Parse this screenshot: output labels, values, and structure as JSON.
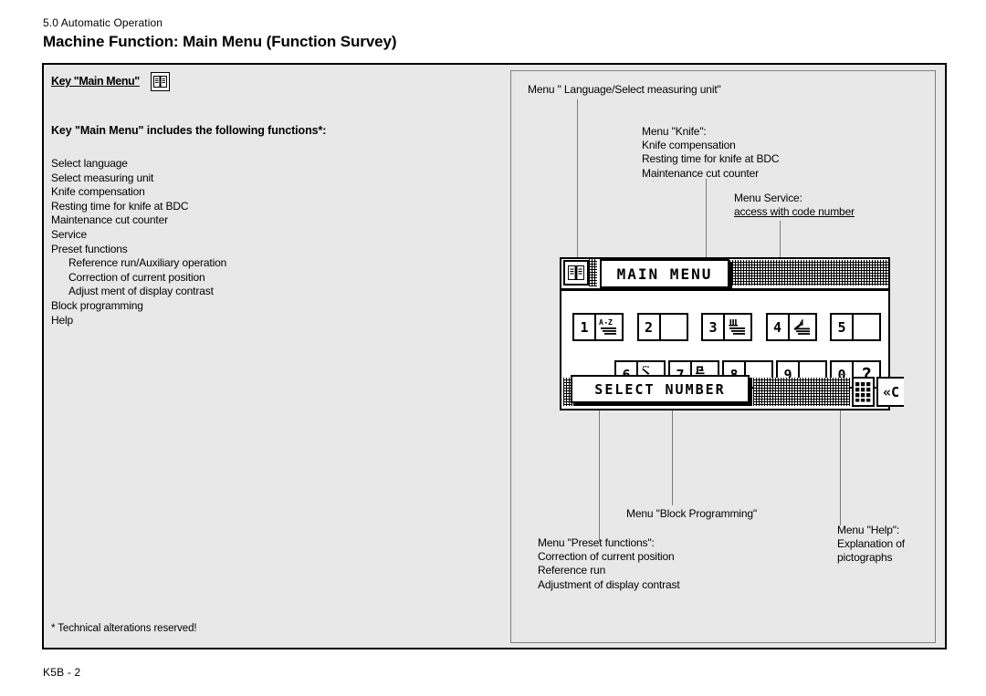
{
  "header": {
    "section_number": "5.0 Automatic Operation",
    "title": "Machine Function: Main Menu (Function Survey)"
  },
  "left_column": {
    "key_label": "Key \"Main Menu\"",
    "key_icon": "open-book-icon",
    "functions_heading": "Key \"Main Menu\" includes the following functions*:",
    "functions": [
      {
        "label": "Select language",
        "indent": 0
      },
      {
        "label": "Select measuring unit",
        "indent": 0
      },
      {
        "label": "Knife compensation",
        "indent": 0
      },
      {
        "label": "Resting time for knife at BDC",
        "indent": 0
      },
      {
        "label": "Maintenance cut counter",
        "indent": 0
      },
      {
        "label": "Service",
        "indent": 0
      },
      {
        "label": "Preset functions",
        "indent": 0
      },
      {
        "label": "Reference run/Auxiliary operation",
        "indent": 1
      },
      {
        "label": "Correction of current position",
        "indent": 1
      },
      {
        "label": "Adjust ment of display contrast",
        "indent": 1
      },
      {
        "label": "Block programming",
        "indent": 0
      },
      {
        "label": "Help",
        "indent": 0
      }
    ],
    "footnote": "* Technical alterations reserved!"
  },
  "right_panel": {
    "annotations": [
      {
        "name": "annotation-language",
        "lines": [
          {
            "text": "Menu \" Language/Select measuring unit\"",
            "underlined": false
          }
        ]
      },
      {
        "name": "annotation-knife",
        "lines": [
          {
            "text": "Menu \"Knife\":",
            "underlined": false
          },
          {
            "text": "Knife compensation",
            "underlined": false
          },
          {
            "text": "Resting time for knife at BDC",
            "underlined": false
          },
          {
            "text": "Maintenance cut counter",
            "underlined": false
          }
        ]
      },
      {
        "name": "annotation-service",
        "lines": [
          {
            "text": "Menu Service:",
            "underlined": false
          },
          {
            "text": "access with code number",
            "underlined": true
          }
        ]
      },
      {
        "name": "annotation-block-programming",
        "lines": [
          {
            "text": "Menu \"Block Programming\"",
            "underlined": false
          }
        ]
      },
      {
        "name": "annotation-preset-functions",
        "lines": [
          {
            "text": "Menu \"Preset functions\":",
            "underlined": false
          },
          {
            "text": "Correction of current position",
            "underlined": false
          },
          {
            "text": "Reference run",
            "underlined": false
          },
          {
            "text": "Adjustment of display contrast",
            "underlined": false
          }
        ]
      },
      {
        "name": "annotation-help",
        "lines": [
          {
            "text": "Menu \"Help\":",
            "underlined": false
          },
          {
            "text": "Explanation of",
            "underlined": false
          },
          {
            "text": "pictographs",
            "underlined": false
          }
        ]
      }
    ]
  },
  "lcd": {
    "title": "MAIN MENU",
    "status": "SELECT NUMBER",
    "book_icon": "open-book-icon",
    "keypad_icon": "keypad-icon",
    "clear_label": "«C",
    "row1": [
      {
        "number": "1",
        "icon": "language-az-icon"
      },
      {
        "number": "2",
        "icon": ""
      },
      {
        "number": "3",
        "icon": "knife-icon"
      },
      {
        "number": "4",
        "icon": "wrench-service-icon"
      },
      {
        "number": "5",
        "icon": ""
      }
    ],
    "row2": [
      {
        "number": "6",
        "icon": "preset-functions-icon"
      },
      {
        "number": "7",
        "icon": "block-programming-icon"
      },
      {
        "number": "8",
        "icon": ""
      },
      {
        "number": "9",
        "icon": ""
      },
      {
        "number": "0",
        "icon": "question-mark-icon"
      }
    ]
  },
  "footer": {
    "page_id": "K5B - 2"
  },
  "colors": {
    "panel_background": "#e8e8e8",
    "border": "#000000",
    "leader_line": "#7a7a7a",
    "lcd_background": "#ffffff"
  }
}
